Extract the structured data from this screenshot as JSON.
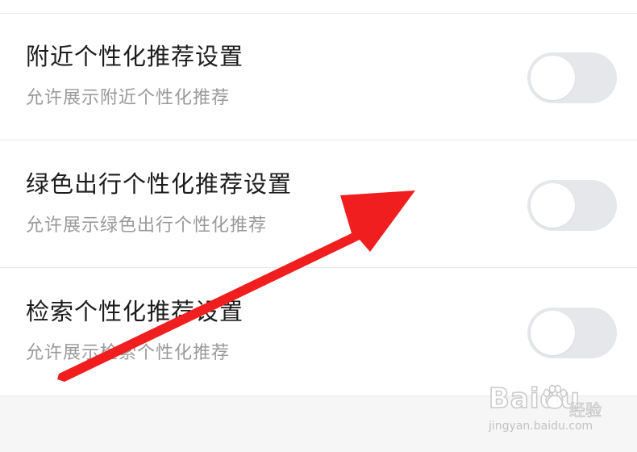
{
  "settings": {
    "items": [
      {
        "title": "附近个性化推荐设置",
        "subtitle": "允许展示附近个性化推荐",
        "enabled": false
      },
      {
        "title": "绿色出行个性化推荐设置",
        "subtitle": "允许展示绿色出行个性化推荐",
        "enabled": false
      },
      {
        "title": "检索个性化推荐设置",
        "subtitle": "允许展示检索个性化推荐",
        "enabled": false
      }
    ]
  },
  "annotation": {
    "icon": "red-arrow-icon",
    "color": "#f01e1e"
  },
  "watermark": {
    "logo": "Baidu",
    "label": "经验",
    "url": "jingyan.baidu.com"
  },
  "colors": {
    "toggle_off": "#e5e7eb",
    "title_text": "#1d1d1d",
    "subtitle_text": "#9a9a9a"
  }
}
